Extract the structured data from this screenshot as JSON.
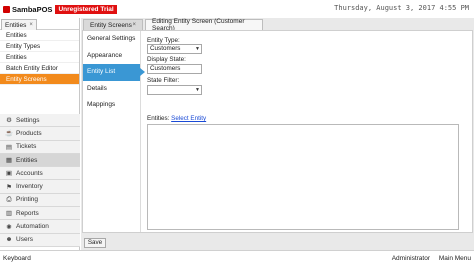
{
  "app": {
    "logo_text": "SambaPOS",
    "trial_badge": "Unregistered Trial",
    "clock": "Thursday, August 3, 2017 4:55 PM"
  },
  "sidebar": {
    "tab_label": "Entities",
    "tab_close": "×",
    "sub_items": [
      {
        "label": "Entities"
      },
      {
        "label": "Entity Types"
      },
      {
        "label": "Entities"
      },
      {
        "label": "Batch Entity Editor"
      },
      {
        "label": "Entity Screens"
      }
    ],
    "nav_items": [
      {
        "label": "Settings",
        "icon": "gear-icon"
      },
      {
        "label": "Products",
        "icon": "products-icon"
      },
      {
        "label": "Tickets",
        "icon": "tickets-icon"
      },
      {
        "label": "Entities",
        "icon": "entities-icon"
      },
      {
        "label": "Accounts",
        "icon": "accounts-icon"
      },
      {
        "label": "Inventory",
        "icon": "inventory-icon"
      },
      {
        "label": "Printing",
        "icon": "printer-icon"
      },
      {
        "label": "Reports",
        "icon": "reports-icon"
      },
      {
        "label": "Automation",
        "icon": "automation-icon"
      },
      {
        "label": "Users",
        "icon": "users-icon"
      }
    ]
  },
  "main": {
    "tabs": [
      {
        "label": "Entity Screens",
        "close": "×"
      },
      {
        "label": "Editing Entity Screen (Customer Search)",
        "close": "×"
      }
    ],
    "left_menu": [
      {
        "label": "General Settings"
      },
      {
        "label": "Appearance"
      },
      {
        "label": "Entity List"
      },
      {
        "label": "Details"
      },
      {
        "label": "Mappings"
      }
    ],
    "form": {
      "entity_type_label": "Entity Type:",
      "entity_type_value": "Customers",
      "display_state_label": "Display State:",
      "display_state_value": "Customers",
      "state_filter_label": "State Filter:",
      "state_filter_value": "",
      "entities_label": "Entities:",
      "select_entity_link": "Select Entity"
    },
    "save_label": "Save"
  },
  "status": {
    "left": "Keyboard",
    "user": "Administrator",
    "menu": "Main Menu"
  },
  "colors": {
    "accent_orange": "#f28a1c",
    "accent_blue": "#3a97d4",
    "trial_red": "#e01010",
    "link_blue": "#1a4ad6"
  }
}
